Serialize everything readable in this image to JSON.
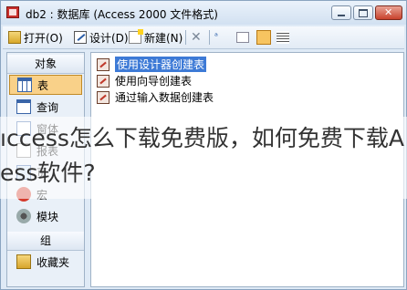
{
  "window": {
    "title": "db2 : 数据库 (Access 2000 文件格式)"
  },
  "toolbar": {
    "open_label": "打开(O)",
    "design_label": "设计(D)",
    "new_label": "新建(N)"
  },
  "objects_panel": {
    "header": "对象",
    "items": [
      {
        "label": "表",
        "icon": "table-icon"
      },
      {
        "label": "查询",
        "icon": "query-icon"
      },
      {
        "label": "窗体",
        "icon": "form-icon"
      },
      {
        "label": "报表",
        "icon": "report-icon"
      },
      {
        "label": "页",
        "icon": "page-icon"
      },
      {
        "label": "宏",
        "icon": "macro-icon"
      },
      {
        "label": "模块",
        "icon": "module-icon"
      }
    ],
    "groups_header": "组",
    "groups": [
      {
        "label": "收藏夹",
        "icon": "folder-icon"
      }
    ]
  },
  "list": {
    "items": [
      {
        "label": "使用设计器创建表",
        "selected": true
      },
      {
        "label": "使用向导创建表",
        "selected": false
      },
      {
        "label": "通过输入数据创建表",
        "selected": false
      }
    ]
  },
  "overlay": {
    "line1": "ıccess怎么下载免费版，如何免费下载A",
    "line2": "ess软件?"
  }
}
